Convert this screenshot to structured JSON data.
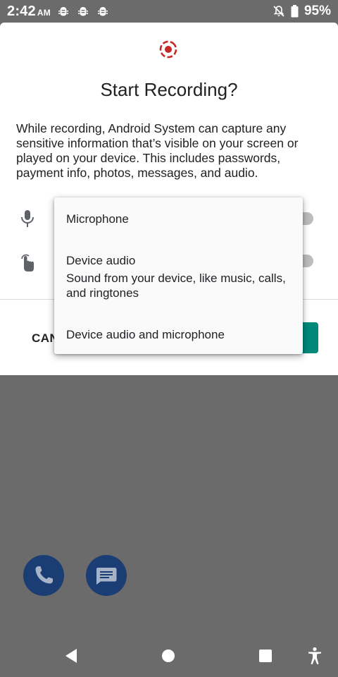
{
  "status_bar": {
    "time": "2:42",
    "ampm": "AM",
    "notification_icons": [
      "android-debug-icon",
      "android-debug-icon",
      "android-debug-icon"
    ],
    "battery_percent": "95%"
  },
  "dialog": {
    "title": "Start Recording?",
    "body": "While recording, Android System can capture any sensitive information that’s visible on your screen or played on your device. This includes passwords, payment info, photos, messages, and audio.",
    "cancel_label": "CAN",
    "accent_color": "#00897b",
    "record_icon_color": "#c62828"
  },
  "audio_source_dropdown": {
    "options": [
      {
        "label": "Microphone"
      },
      {
        "label": "Device audio",
        "description": "Sound from your device, like music, calls, and ringtones"
      },
      {
        "label": "Device audio and microphone"
      }
    ]
  },
  "nav_bar": {
    "items": [
      "back-icon",
      "home-icon",
      "recents-icon",
      "accessibility-icon"
    ]
  }
}
